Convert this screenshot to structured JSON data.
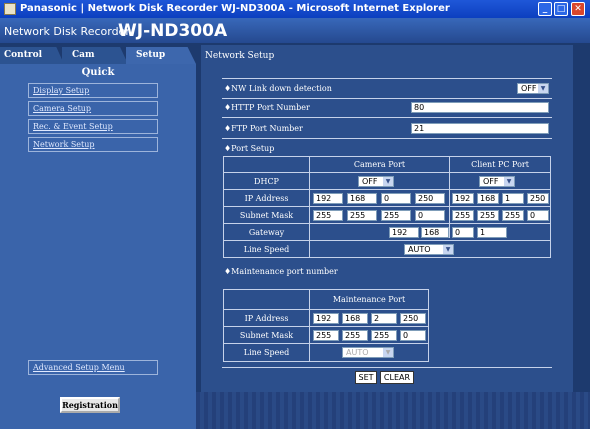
{
  "window": {
    "title": "Panasonic | Network Disk Recorder WJ-ND300A - Microsoft Internet Explorer"
  },
  "header": {
    "subtitle": "Network Disk Recorder",
    "model": "WJ-ND300A"
  },
  "tabs": [
    "Control",
    "Cam Select",
    "Setup"
  ],
  "sidebar": {
    "section": "Quick",
    "items": [
      "Display Setup",
      "Camera Setup",
      "Rec. & Event Setup",
      "Network Setup"
    ],
    "advanced": "Advanced Setup Menu",
    "registration": "Registration"
  },
  "page": {
    "title": "Network Setup",
    "nw_link_label": "♦NW Link down detection",
    "nw_link_value": "OFF",
    "http_label": "♦HTTP Port Number",
    "http_value": "80",
    "ftp_label": "♦FTP Port Number",
    "ftp_value": "21",
    "port_setup_label": "♦Port Setup",
    "maint_label": "♦Maintenance port number"
  },
  "port_table": {
    "col_camera": "Camera Port",
    "col_client": "Client PC Port",
    "rows": {
      "dhcp": "DHCP",
      "ip": "IP Address",
      "subnet": "Subnet Mask",
      "gateway": "Gateway",
      "line_speed": "Line Speed"
    },
    "camera_dhcp": "OFF",
    "client_dhcp": "OFF",
    "camera_ip": [
      "192",
      "168",
      "0",
      "250"
    ],
    "client_ip": [
      "192",
      "168",
      "1",
      "250"
    ],
    "camera_subnet": [
      "255",
      "255",
      "255",
      "0"
    ],
    "client_subnet": [
      "255",
      "255",
      "255",
      "0"
    ],
    "gateway": [
      "192",
      "168",
      "0",
      "1"
    ],
    "line_speed": "AUTO"
  },
  "maint_table": {
    "col": "Maintenance Port",
    "rows": {
      "ip": "IP Address",
      "subnet": "Subnet Mask",
      "line_speed": "Line Speed"
    },
    "ip": [
      "192",
      "168",
      "2",
      "250"
    ],
    "subnet": [
      "255",
      "255",
      "255",
      "0"
    ],
    "line_speed": "AUTO"
  },
  "buttons": {
    "set": "SET",
    "clear": "CLEAR"
  }
}
